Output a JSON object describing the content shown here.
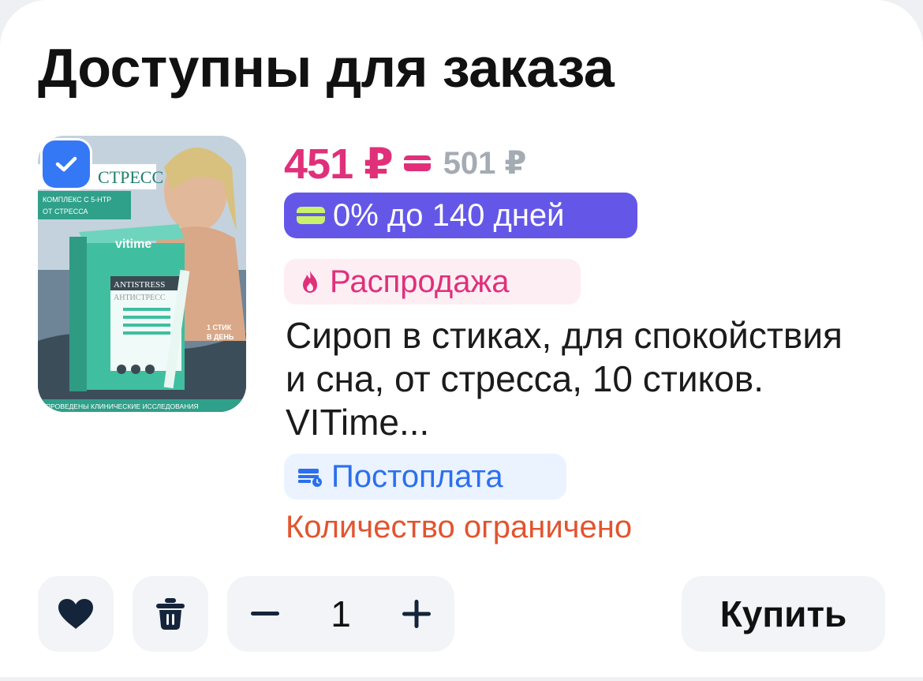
{
  "section": {
    "title": "Доступны для заказа"
  },
  "product": {
    "selected": true,
    "image": {
      "pack_brand": "vitime",
      "pack_name_en": "ANTISTRESS",
      "pack_name_ru": "АНТИСТРЕСС",
      "headline": "СТРЕСС",
      "subline_1": "КОМПЛЕКС С 5-НТР",
      "subline_2": "ОТ СТРЕССА",
      "dose_1": "1 СТИК",
      "dose_2": "В ДЕНЬ",
      "footer": "ПРОВЕДЕНЫ КЛИНИЧЕСКИЕ ИССЛЕДОВАНИЯ"
    },
    "price_current": "451 ₽",
    "price_old": "501 ₽",
    "split_label": "0% до 140 дней",
    "sale_label": "Распродажа",
    "name": "Сироп в стиках, для спокойствия и сна, от стресса, 10 стиков. VITime...",
    "postpay_label": "Постоплата",
    "stock_note": "Количество ограничено",
    "quantity": "1",
    "buy_label": "Купить"
  },
  "colors": {
    "price_accent": "#e0307a",
    "split_badge_bg": "#6457e8",
    "checkbox": "#3478f6",
    "postpay": "#2b6ff0",
    "stock_note": "#e2542f"
  },
  "icons": {
    "checkbox": "check-icon",
    "sale": "fire-icon",
    "postpay": "wallet-icon",
    "favorite": "heart-icon",
    "delete": "trash-icon",
    "decrease": "minus-icon",
    "increase": "plus-icon"
  }
}
